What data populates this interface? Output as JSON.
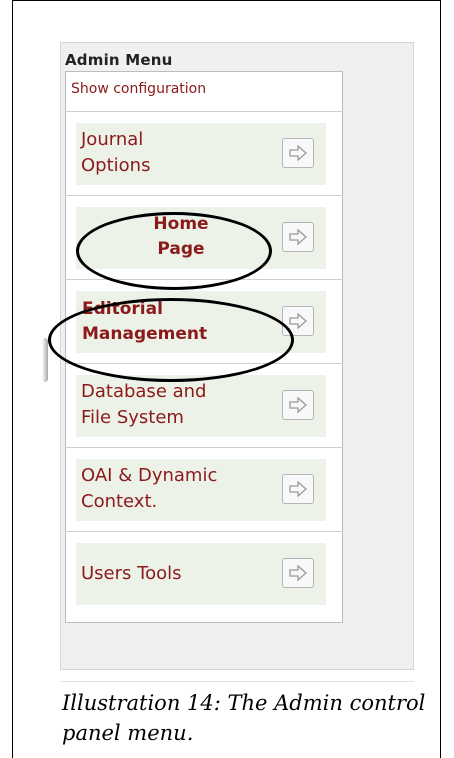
{
  "panel": {
    "title": "Admin Menu",
    "show_configuration": "Show configuration"
  },
  "menu_items": [
    {
      "line1": "Journal",
      "line2": "Options",
      "highlighted": false
    },
    {
      "line1": "Home",
      "line2": "Page",
      "highlighted": true
    },
    {
      "line1": "Editorial",
      "line2": "Management",
      "highlighted": true
    },
    {
      "line1": "Database and",
      "line2": "File System",
      "highlighted": false
    },
    {
      "line1": "OAI & Dynamic",
      "line2": "Context.",
      "highlighted": false
    },
    {
      "line1": "Users Tools",
      "line2": "",
      "highlighted": false
    }
  ],
  "icons": {
    "arrow": "arrow-right-icon"
  },
  "colors": {
    "link": "#8b1a1a",
    "item_background": "#edf2e8",
    "panel_background": "#f0f0f0"
  },
  "caption": {
    "text": "Illustration 14: The Admin control panel menu."
  }
}
